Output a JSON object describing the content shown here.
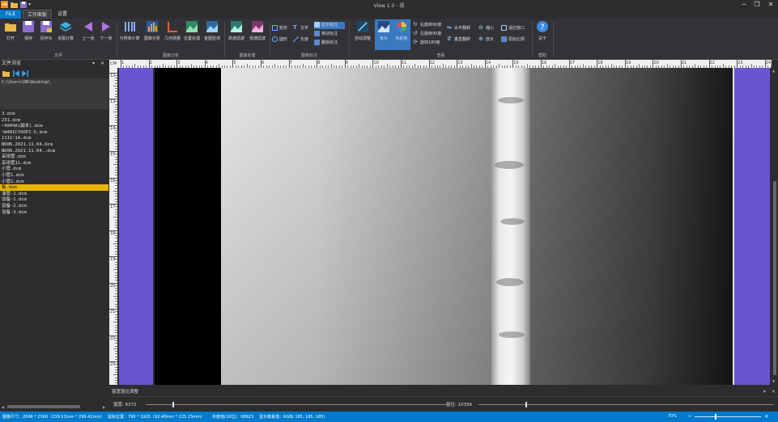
{
  "titlebar": {
    "title": "View 1.0 - 视",
    "app_badge": "CN",
    "win_min": "─",
    "win_restore": "❐",
    "win_close": "✕"
  },
  "tabs": [
    "FILE",
    "工作面板",
    "设置"
  ],
  "ribbon": {
    "file_group": {
      "label": "文件",
      "buttons": [
        "打开",
        "保存",
        "另存为",
        "多图计算",
        "上一张",
        "下一张"
      ]
    },
    "analysis_group": {
      "label": "图像分析",
      "buttons": [
        "分辨率计算",
        "图像分析",
        "几何测量",
        "位置处理",
        "金图检测"
      ]
    },
    "process_group": {
      "label": "图像处理",
      "buttons": [
        "高通滤波",
        "低通滤波"
      ]
    },
    "annot_group": {
      "label": "图像标注",
      "shapes": [
        "矩形",
        "圆形"
      ],
      "tools": [
        "文字",
        "长度"
      ],
      "actions": [
        "显示标注",
        "移动标注",
        "删除标注"
      ]
    },
    "view_group": {
      "label": "查看",
      "auto_adjust": "自动调整",
      "negative": "负片",
      "pseudo_color": "伪彩色",
      "rotations": [
        "右旋转90度",
        "左旋转90度",
        "旋转180度"
      ],
      "flips": [
        "水平翻转",
        "垂直翻转"
      ],
      "zoom": [
        "缩小",
        "放大"
      ],
      "fit": [
        "适应窗口",
        "原始比例"
      ]
    },
    "help_group": {
      "label": "帮助",
      "about": "关于"
    }
  },
  "left_panel": {
    "title": "文件浏览",
    "pin": "▾",
    "close": "✕",
    "path": "C:\\Users\\DR\\Desktop\\",
    "files": [
      "3.dcm",
      "231.dcm",
      "~4044A(副本).dcm",
      "~W48ICYOOP1-5.dcm",
      "1111~1A.dcm",
      "ND06.2021.11.04.dcm",
      "ND06.2021.11.04..dcm",
      "采用管.dcm",
      "采用管11.dcm",
      "小管.dcm",
      "小管1.dcm",
      "小管2.dcm",
      "板.dcm",
      "油管-1.dcm",
      "设备-1.dcm",
      "设备-2.dcm",
      "设备-3.dcm"
    ],
    "selected_index": 12
  },
  "viewer": {
    "ruler_corner": "CM",
    "ruler_top": [
      "1",
      "2",
      "3",
      "4",
      "5",
      "6",
      "7",
      "8",
      "9",
      "10",
      "11",
      "12",
      "13",
      "14",
      "15",
      "16",
      "17",
      "18",
      "19",
      "20",
      "21",
      "22",
      "23",
      "24"
    ],
    "ruler_left": [
      "12",
      "13",
      "14",
      "15",
      "16",
      "17",
      "18",
      "19",
      "20",
      "21",
      "22",
      "23",
      "24"
    ]
  },
  "adjust_panel": {
    "title": "窗宽窗位调整",
    "pin": "▾",
    "close": "✕",
    "window_width_label": "窗宽: 6372",
    "window_level_label": "窗位: 10356",
    "window_width_value": 0.09,
    "window_level_value": 0.16
  },
  "status": {
    "image_size": "图像尺寸：2048 * 2560（239.53mm * 299.42mm）",
    "mouse_pos": "鼠标位置：790 * 1925（92.40mm * 225.15mm）",
    "gray_value": "灰度值(16位)：08923",
    "display_pixel": "显示像素值：RGB( 185, 185, 185)",
    "zoom": "70%",
    "zoom_minus": "−",
    "zoom_plus": "+",
    "zoom_value": 0.3
  },
  "colors": {
    "accent": "#007acc",
    "selected_file": "#e8b500",
    "margin_purple": "#6a55d0"
  }
}
